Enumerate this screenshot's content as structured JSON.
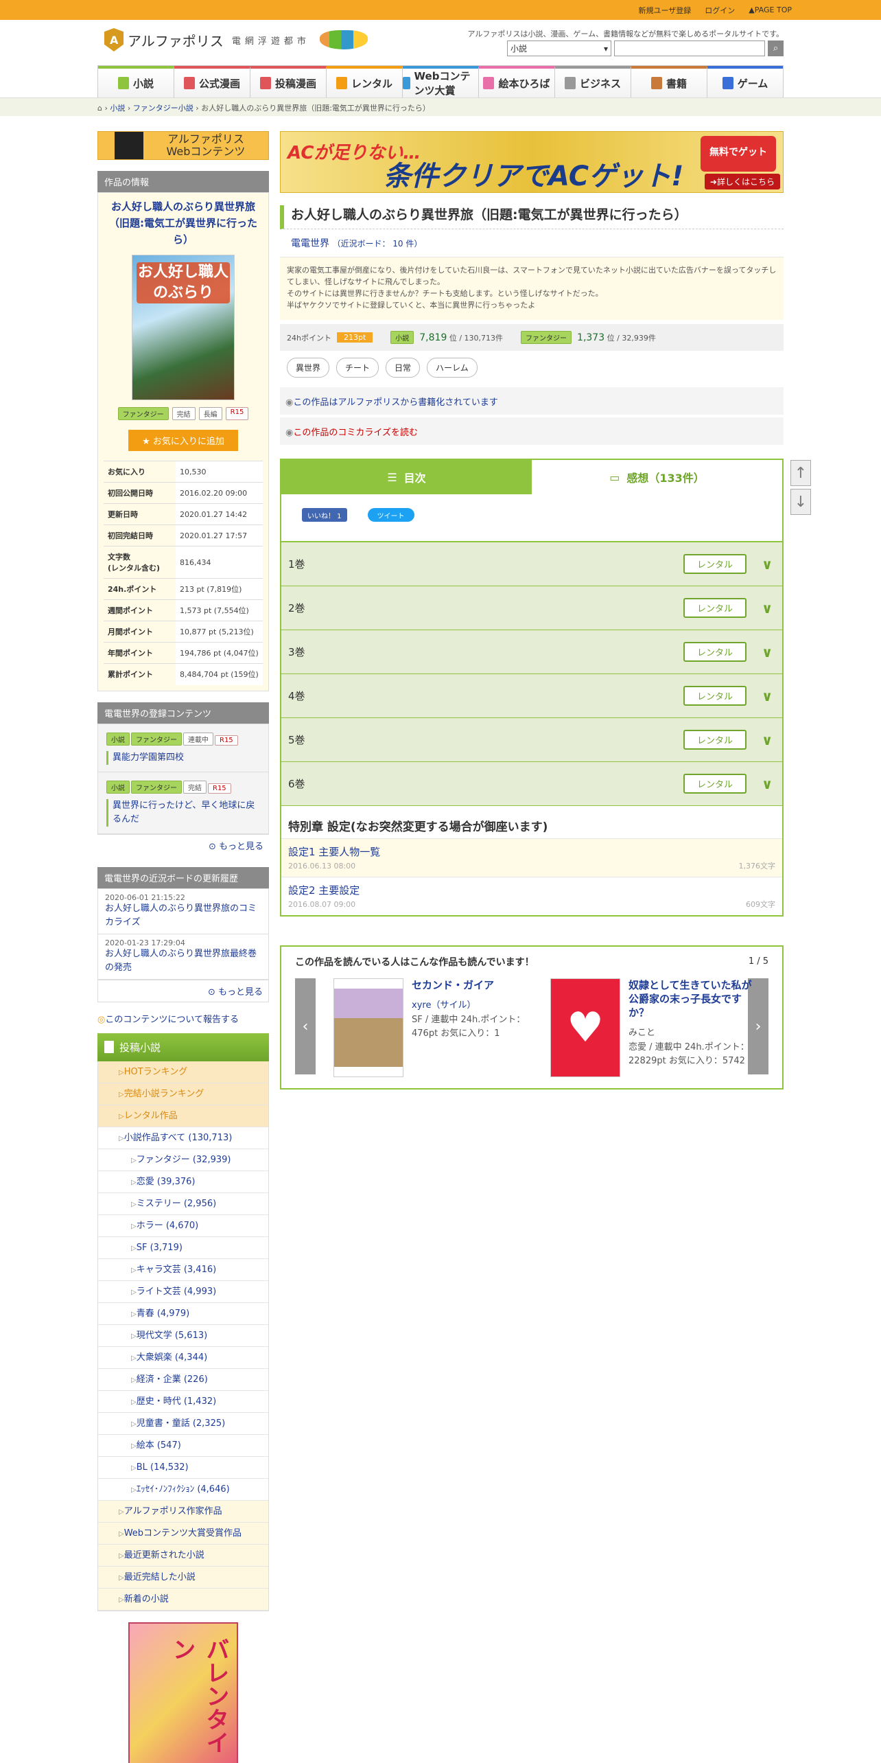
{
  "topbar": {
    "register": "新規ユーザ登録",
    "login": "ログイン",
    "pagetop": "PAGE TOP"
  },
  "header": {
    "logo": "アルファポリス",
    "logo_sub": "電網浮遊都市",
    "tagline": "アルファポリスは小説、漫画、ゲーム、書籍情報などが無料で楽しめるポータルサイトです。",
    "search_select": "小説"
  },
  "nav": [
    "小説",
    "公式漫画",
    "投稿漫画",
    "レンタル",
    "Webコンテンツ大賞",
    "絵本ひろば",
    "ビジネス",
    "書籍",
    "ゲーム"
  ],
  "nav_colors": [
    "#8fc43f",
    "#e0555a",
    "#e0555a",
    "#f29d12",
    "#3a9ad9",
    "#e86fa8",
    "#999999",
    "#c97a3a",
    "#3a6fd9"
  ],
  "breadcrumb": {
    "c1": "小説",
    "c2": "ファンタジー小説",
    "c3": "お人好し職人のぶらり異世界旅（旧題:電気工が異世界に行ったら）"
  },
  "sidebar": {
    "web_banner_1": "アルファポリス",
    "web_banner_2": "Webコンテンツ",
    "info_header": "作品の情報",
    "title": "お人好し職人のぶらり異世界旅（旧題:電気工が異世界に行ったら）",
    "cover_text": "お人好し職人のぶらり",
    "tags": [
      "ファンタジー",
      "完結",
      "長編",
      "R15"
    ],
    "fav_button": "お気に入りに追加",
    "stats": [
      {
        "k": "お気に入り",
        "v": "10,530"
      },
      {
        "k": "初回公開日時",
        "v": "2016.02.20 09:00"
      },
      {
        "k": "更新日時",
        "v": "2020.01.27 14:42"
      },
      {
        "k": "初回完結日時",
        "v": "2020.01.27 17:57"
      },
      {
        "k": "文字数\n(レンタル含む)",
        "v": "816,434"
      },
      {
        "k": "24h.ポイント",
        "v": "213 pt (7,819位)"
      },
      {
        "k": "週間ポイント",
        "v": "1,573 pt (7,554位)"
      },
      {
        "k": "月間ポイント",
        "v": "10,877 pt (5,213位)"
      },
      {
        "k": "年間ポイント",
        "v": "194,786 pt (4,047位)"
      },
      {
        "k": "累計ポイント",
        "v": "8,484,704 pt (159位)"
      }
    ],
    "reg_header": "電電世界の登録コンテンツ",
    "reg_items": [
      {
        "tags": [
          "小説",
          "ファンタジー",
          "連載中",
          "R15"
        ],
        "title": "異能力学園第四校"
      },
      {
        "tags": [
          "小説",
          "ファンタジー",
          "完結",
          "R15"
        ],
        "title": "異世界に行ったけど、早く地球に戻るんだ"
      }
    ],
    "more": "もっと見る",
    "hist_header": "電電世界の近況ボードの更新履歴",
    "history": [
      {
        "date": "2020-06-01 21:15:22",
        "title": "お人好し職人のぶらり異世界旅のコミカライズ"
      },
      {
        "date": "2020-01-23 17:29:04",
        "title": "お人好し職人のぶらり異世界旅最終巻の発売"
      }
    ],
    "more2": "もっと見る",
    "report": "このコンテンツについて報告する",
    "novel_header": "投稿小説",
    "novel_links": [
      {
        "t": "HOTランキング",
        "k": "o"
      },
      {
        "t": "完結小説ランキング",
        "k": "o"
      },
      {
        "t": "レンタル作品",
        "k": "o"
      },
      {
        "t": "小説作品すべて (130,713)",
        "k": "w"
      },
      {
        "t": "ファンタジー (32,939)",
        "k": "s"
      },
      {
        "t": "恋愛 (39,376)",
        "k": "s"
      },
      {
        "t": "ミステリー (2,956)",
        "k": "s"
      },
      {
        "t": "ホラー (4,670)",
        "k": "s"
      },
      {
        "t": "SF (3,719)",
        "k": "s"
      },
      {
        "t": "キャラ文芸 (3,416)",
        "k": "s"
      },
      {
        "t": "ライト文芸 (4,993)",
        "k": "s"
      },
      {
        "t": "青春 (4,979)",
        "k": "s"
      },
      {
        "t": "現代文学 (5,613)",
        "k": "s"
      },
      {
        "t": "大衆娯楽 (4,344)",
        "k": "s"
      },
      {
        "t": "経済・企業 (226)",
        "k": "s"
      },
      {
        "t": "歴史・時代 (1,432)",
        "k": "s"
      },
      {
        "t": "児童書・童話 (2,325)",
        "k": "s"
      },
      {
        "t": "絵本 (547)",
        "k": "s"
      },
      {
        "t": "BL (14,532)",
        "k": "s"
      },
      {
        "t": "ｴｯｾｲ･ﾉﾝﾌｨｸｼｮﾝ (4,646)",
        "k": "s"
      },
      {
        "t": "アルファポリス作家作品",
        "k": "y"
      },
      {
        "t": "Webコンテンツ大賞受賞作品",
        "k": "y"
      },
      {
        "t": "最近更新された小説",
        "k": "y"
      },
      {
        "t": "最近完結した小説",
        "k": "y"
      },
      {
        "t": "新着の小説",
        "k": "y"
      }
    ],
    "ad_text": "バレンタイン"
  },
  "main": {
    "banner_1": "ACが足りない…",
    "banner_2": "条件クリアでACゲット!",
    "banner_3": "無料でゲット",
    "banner_4": "詳しくはこちら",
    "title": "お人好し職人のぶらり異世界旅（旧題:電気工が異世界に行ったら）",
    "author": "電電世界",
    "board": "（近況ボード： 10 件）",
    "synopsis": "実家の電気工事屋が倒産になり、後片付けをしていた石川良一は、スマートフォンで見ていたネット小説に出ていた広告バナーを誤ってタッチしてしまい、怪しげなサイトに飛んでしまった。\nそのサイトには異世界に行きませんか？チートも支給します。という怪しげなサイトだった。\n半ばヤケクソでサイトに登録していくと、本当に異世界に行っちゃったよ",
    "pt_label": "24hポイント",
    "pt": "213pt",
    "rank1_tag": "小説",
    "rank1": "7,819",
    "rank1_of": "位 / 130,713件",
    "rank2_tag": "ファンタジー",
    "rank2": "1,373",
    "rank2_of": "位 / 32,939件",
    "keywords": [
      "異世界",
      "チート",
      "日常",
      "ハーレム"
    ],
    "link_book": "この作品はアルファポリスから書籍化されています",
    "link_comic": "この作品のコミカライズを読む",
    "tab_toc": "目次",
    "tab_comments": "感想（133件）",
    "like": "いいね！ 1",
    "tweet": "ツイート",
    "volumes": [
      "1巻",
      "2巻",
      "3巻",
      "4巻",
      "5巻",
      "6巻"
    ],
    "rent": "レンタル",
    "chapter": "特別章 設定(なお突然変更する場合が御座います)",
    "episodes": [
      {
        "t": "設定1 主要人物一覧",
        "d": "2016.06.13 08:00",
        "c": "1,376文字"
      },
      {
        "t": "設定2 主要設定",
        "d": "2016.08.07 09:00",
        "c": "609文字"
      }
    ],
    "rec_header": "この作品を読んでいる人はこんな作品も読んでいます！",
    "rec_page": "1 / 5",
    "recs": [
      {
        "t": "セカンド・ガイア",
        "a": "xyre（サイル）",
        "d": "SF / 連載中 24h.ポイント：476pt お気に入り：1"
      },
      {
        "t": "奴隷として生きていた私が公爵家の末っ子長女ですか？",
        "a": "みこと",
        "d": "恋愛 / 連載中 24h.ポイント：22829pt お気に入り：5742"
      }
    ]
  }
}
